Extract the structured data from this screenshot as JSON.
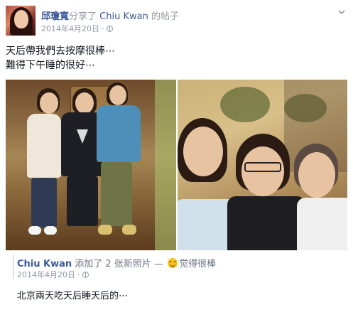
{
  "header": {
    "author": "邱瓊寬",
    "shared_text": "分享了",
    "original_author": "Chiu Kwan",
    "post_suffix": "的帖子",
    "date": "2014年4月20日",
    "separator": "·"
  },
  "message": {
    "line1": "天后帶我們去按摩很棒⋯",
    "line2": "難得下午睡的很好⋯"
  },
  "photos": [
    {
      "name": "group-photo-standing"
    },
    {
      "name": "group-selfie"
    }
  ],
  "shared_post": {
    "author": "Chiu Kwan",
    "action": "添加了 2 张新照片 —",
    "feeling": "觉得很棒",
    "date": "2014年4月20日",
    "separator": "·",
    "text": "北京兩天吃天后睡天后的⋯"
  },
  "icons": {
    "globe": "globe-icon",
    "chevron": "chevron-down-icon",
    "feeling": "smiley-icon"
  },
  "colors": {
    "link": "#3b5998",
    "meta": "#9197a3"
  }
}
